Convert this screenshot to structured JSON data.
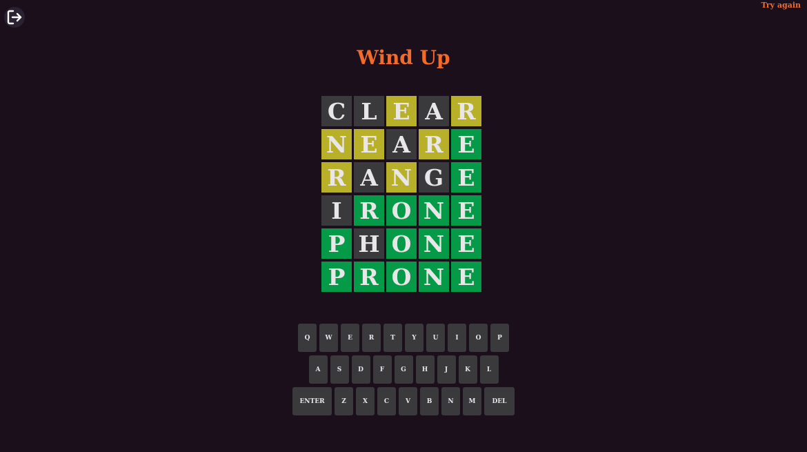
{
  "header": {
    "title": "Wind Up",
    "try_again": "Try again",
    "exit_icon": "exit-icon"
  },
  "colors": {
    "background": "#1b0f1c",
    "accent": "#f26b2a",
    "gray": "#3a3a3c",
    "yellow": "#b9b02a",
    "green": "#049a47"
  },
  "board": {
    "rows": [
      [
        {
          "letter": "C",
          "state": "gray"
        },
        {
          "letter": "L",
          "state": "gray"
        },
        {
          "letter": "E",
          "state": "yellow"
        },
        {
          "letter": "A",
          "state": "gray"
        },
        {
          "letter": "R",
          "state": "yellow"
        }
      ],
      [
        {
          "letter": "N",
          "state": "yellow"
        },
        {
          "letter": "E",
          "state": "yellow"
        },
        {
          "letter": "A",
          "state": "gray"
        },
        {
          "letter": "R",
          "state": "yellow"
        },
        {
          "letter": "E",
          "state": "green"
        }
      ],
      [
        {
          "letter": "R",
          "state": "yellow"
        },
        {
          "letter": "A",
          "state": "gray"
        },
        {
          "letter": "N",
          "state": "yellow"
        },
        {
          "letter": "G",
          "state": "gray"
        },
        {
          "letter": "E",
          "state": "green"
        }
      ],
      [
        {
          "letter": "I",
          "state": "gray"
        },
        {
          "letter": "R",
          "state": "green"
        },
        {
          "letter": "O",
          "state": "green"
        },
        {
          "letter": "N",
          "state": "green"
        },
        {
          "letter": "E",
          "state": "green"
        }
      ],
      [
        {
          "letter": "P",
          "state": "green"
        },
        {
          "letter": "H",
          "state": "gray"
        },
        {
          "letter": "O",
          "state": "green"
        },
        {
          "letter": "N",
          "state": "green"
        },
        {
          "letter": "E",
          "state": "green"
        }
      ],
      [
        {
          "letter": "P",
          "state": "green"
        },
        {
          "letter": "R",
          "state": "green"
        },
        {
          "letter": "O",
          "state": "green"
        },
        {
          "letter": "N",
          "state": "green"
        },
        {
          "letter": "E",
          "state": "green"
        }
      ]
    ]
  },
  "keyboard": {
    "rows": [
      [
        "Q",
        "W",
        "E",
        "R",
        "T",
        "Y",
        "U",
        "I",
        "O",
        "P"
      ],
      [
        "A",
        "S",
        "D",
        "F",
        "G",
        "H",
        "J",
        "K",
        "L"
      ],
      [
        "ENTER",
        "Z",
        "X",
        "C",
        "V",
        "B",
        "N",
        "M",
        "DEL"
      ]
    ]
  }
}
